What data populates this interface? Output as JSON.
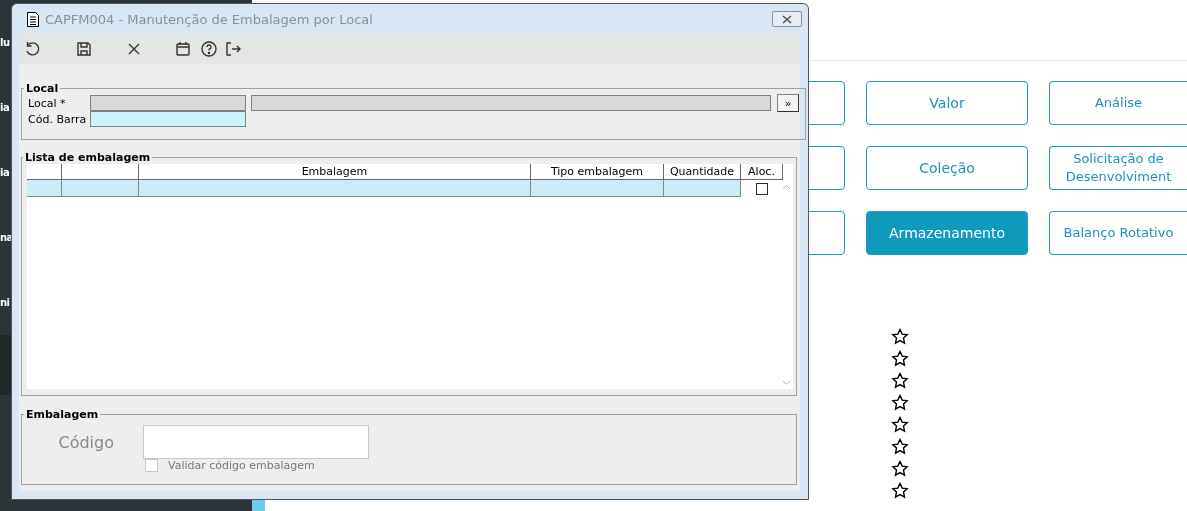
{
  "sidebar": {
    "items": [
      {
        "label": "lu"
      },
      {
        "label": "ia"
      },
      {
        "label": "ia"
      },
      {
        "label": "na"
      },
      {
        "label": "ni"
      }
    ]
  },
  "tile_rows": [
    {
      "tiles": [
        {
          "selected": false
        },
        {
          "label": "Valor",
          "selected": false
        },
        {
          "label": "Análise",
          "selected": false
        }
      ]
    },
    {
      "tiles": [
        {
          "selected": false
        },
        {
          "label": "Coleção",
          "selected": false
        },
        {
          "label": "Solicitação de Desenvolviment",
          "selected": false
        }
      ]
    },
    {
      "tiles": [
        {
          "selected": false
        },
        {
          "label": "Armazenamento",
          "selected": true
        },
        {
          "label": "Balanço Rotativo",
          "selected": false
        }
      ]
    }
  ],
  "favorites": [
    {
      "favorite": false
    },
    {
      "favorite": false
    },
    {
      "favorite": false
    },
    {
      "favorite": false
    },
    {
      "favorite": false
    },
    {
      "favorite": false
    },
    {
      "favorite": false
    },
    {
      "favorite": false
    }
  ],
  "window": {
    "title": "CAPFM004 - Manutenção de Embalagem por Local",
    "local": {
      "legend": "Local",
      "local_label": "Local *",
      "barcode_label": "Cód. Barra",
      "lookup_button": "»"
    },
    "list": {
      "legend": "Lista de embalagem",
      "columns": [
        "",
        "",
        "Embalagem",
        "Tipo embalagem",
        "Quantidade",
        "Aloc."
      ],
      "rows": [
        {
          "allocated": false
        }
      ]
    },
    "packaging": {
      "legend": "Embalagem",
      "code_label": "Código",
      "validate": {
        "label": "Validar código embalagem",
        "checked": false,
        "disabled": true
      }
    }
  }
}
